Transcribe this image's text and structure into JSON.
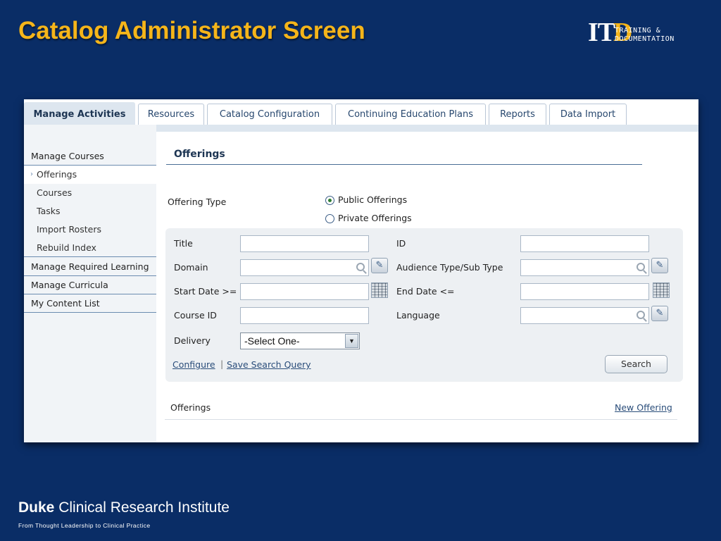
{
  "slide": {
    "title": "Catalog Administrator Screen",
    "logo": {
      "mark": "IT",
      "mark_d": "D",
      "line1": "TRAINING &",
      "line2": "DOCUMENTATION"
    },
    "footer": {
      "brand_bold": "Duke",
      "brand_rest": " Clinical Research Institute",
      "tagline": "From Thought Leadership to Clinical Practice"
    }
  },
  "tabs": [
    {
      "label": "Manage Activities",
      "active": true
    },
    {
      "label": "Resources"
    },
    {
      "label": "Catalog Configuration"
    },
    {
      "label": "Continuing Education Plans"
    },
    {
      "label": "Reports"
    },
    {
      "label": "Data Import"
    }
  ],
  "sidebar": {
    "items": [
      {
        "label": "Manage Courses"
      },
      {
        "label": "Offerings",
        "selected": true,
        "marker": "›"
      },
      {
        "label": "Courses"
      },
      {
        "label": "Tasks"
      },
      {
        "label": "Import Rosters"
      },
      {
        "label": "Rebuild Index"
      },
      {
        "label": "Manage Required Learning"
      },
      {
        "label": "Manage Curricula"
      },
      {
        "label": "My Content List"
      }
    ]
  },
  "main": {
    "title": "Offerings",
    "offering_type": {
      "label": "Offering Type",
      "options": [
        {
          "label": "Public Offerings",
          "checked": true
        },
        {
          "label": "Private Offerings",
          "checked": false
        }
      ]
    },
    "search": {
      "title_label": "Title",
      "id_label": "ID",
      "domain_label": "Domain",
      "audience_label": "Audience Type/Sub Type",
      "start_date_label": "Start Date >=",
      "end_date_label": "End Date <=",
      "course_id_label": "Course ID",
      "language_label": "Language",
      "delivery_label": "Delivery",
      "delivery_value": "-Select One-",
      "configure_link": "Configure",
      "save_query_link": "Save Search Query",
      "search_button": "Search"
    },
    "results": {
      "label": "Offerings",
      "new_link": "New Offering"
    }
  }
}
